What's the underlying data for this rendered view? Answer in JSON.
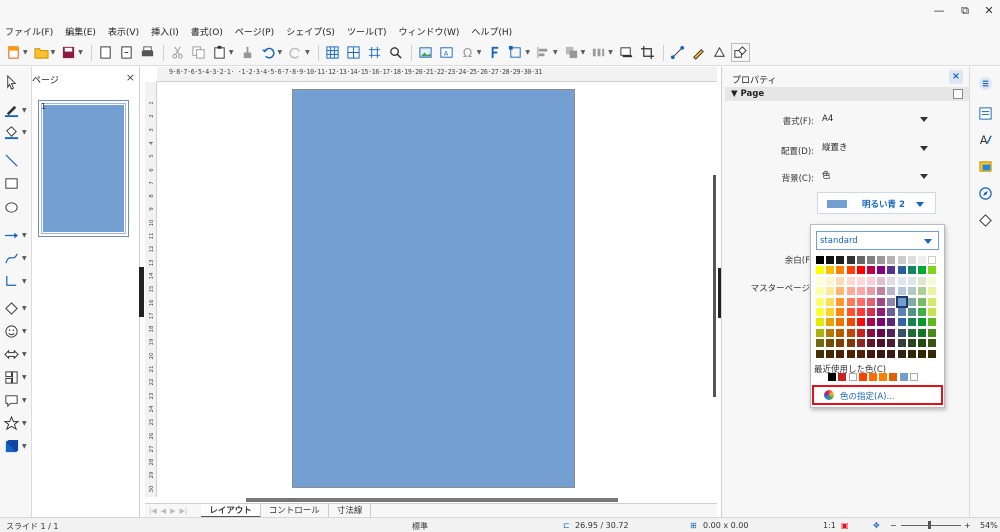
{
  "menu": [
    "ファイル(F)",
    "編集(E)",
    "表示(V)",
    "挿入(I)",
    "書式(O)",
    "ページ(P)",
    "シェイプ(S)",
    "ツール(T)",
    "ウィンドウ(W)",
    "ヘルプ(H)"
  ],
  "window_controls": {
    "minimize": "—",
    "restore": "⧉",
    "close": "✕"
  },
  "slide_pane": {
    "title": "ページ",
    "close": "×",
    "slide_number": "1"
  },
  "ruler": {
    "h_labels": "9·8·7·6·5·4·3·2·1· ·1·2·3·4·5·6·7·8·9·10·11·12·13·14·15·16·17·18·19·20·21·22·23·24·25·26·27·28·29·30·31",
    "v_labels": [
      "1",
      "2",
      "3",
      "4",
      "5",
      "6",
      "7",
      "8",
      "9",
      "10",
      "11",
      "12",
      "13",
      "14",
      "15",
      "16",
      "17",
      "18",
      "19",
      "20",
      "21",
      "22",
      "23",
      "24",
      "25",
      "26",
      "27",
      "28",
      "29",
      "30"
    ]
  },
  "tabs": [
    {
      "label": "レイアウト",
      "active": true
    },
    {
      "label": "コントロール",
      "active": false
    },
    {
      "label": "寸法線",
      "active": false
    }
  ],
  "statusbar": {
    "slide": "スライド 1 / 1",
    "layout": "標準",
    "position": "26.95 / 30.72",
    "size": "0.00 x 0.00",
    "ratio": "1:1",
    "zoom_minus": "−",
    "zoom_plus": "+",
    "zoom": "54%"
  },
  "properties": {
    "title": "プロパティ",
    "close": "×",
    "section": "Page",
    "format_label": "書式(F):",
    "format_value": "A4",
    "orientation_label": "配置(D):",
    "orientation_value": "縦置き",
    "background_label": "背景(C):",
    "background_value": "色",
    "color_name": "明るい青 2",
    "margin_label": "余白(F",
    "master_label": "マスターページ"
  },
  "color_popup": {
    "palette": "standard",
    "recent_label": "最近使用した色(C)",
    "custom_label": "色の指定(A)...",
    "recent_colors": [
      "#000000",
      "#c9211e",
      "#ffffff",
      "#ff4000",
      "#ff6d00",
      "#ff8000",
      "#e16100",
      "#729fcf",
      "#ffffff"
    ],
    "selected_color": "#729fcf"
  },
  "colors": {
    "slide_fill": "#739fd2",
    "accent": "#1565c0",
    "highlight": "#e5101a"
  }
}
